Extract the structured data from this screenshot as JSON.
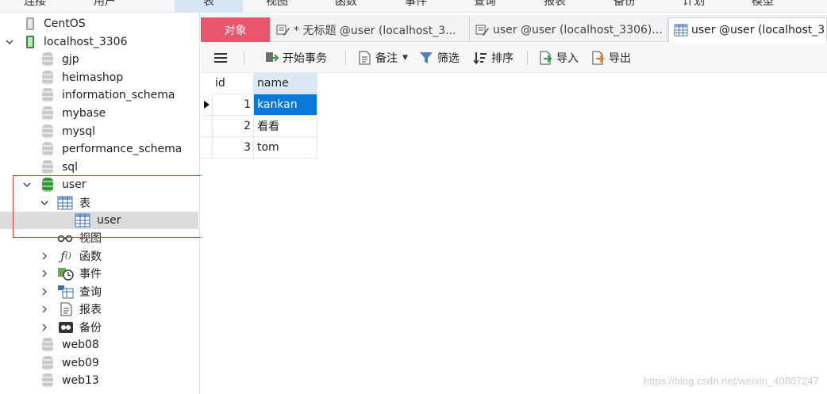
{
  "menu": {
    "items": [
      "连接",
      "用户",
      "表",
      "视图",
      "函数",
      "事件",
      "查询",
      "报表",
      "备份",
      "计划",
      "模型"
    ],
    "active_index": 2
  },
  "tree": {
    "connection_above": "CentOS",
    "connection": "localhost_3306",
    "databases_before": [
      "gjp",
      "heimashop",
      "information_schema",
      "mybase",
      "mysql",
      "performance_schema",
      "sql"
    ],
    "open_db": {
      "name": "user",
      "tables_folder": "表",
      "table": "user",
      "groups": [
        "视图",
        "函数",
        "事件",
        "查询",
        "报表",
        "备份"
      ]
    },
    "databases_after": [
      "web08",
      "web09",
      "web13"
    ]
  },
  "tabs": {
    "objects": "对象",
    "query_untitled": "* 无标题 @user (localhost_3...",
    "query_user": "user @user (localhost_3306)...",
    "table_user": "user @user (localhost_3"
  },
  "toolbar": {
    "menu_icon": "hamburger-icon",
    "begin_transaction": "开始事务",
    "note": "备注",
    "filter": "筛选",
    "sort": "排序",
    "import": "导入",
    "export": "导出"
  },
  "grid": {
    "columns": [
      "id",
      "name"
    ],
    "rows": [
      {
        "id": "1",
        "name": "kankan"
      },
      {
        "id": "2",
        "name": "看看"
      },
      {
        "id": "3",
        "name": "tom"
      }
    ],
    "selected_row": 0
  },
  "colors": {
    "objects_tab": "#e9556b",
    "selection": "#0a78d7",
    "annotation_border": "#e33b3b",
    "db_green": "#2f9a3a"
  },
  "watermark": "https://blog.csdn.net/weixin_40807247"
}
